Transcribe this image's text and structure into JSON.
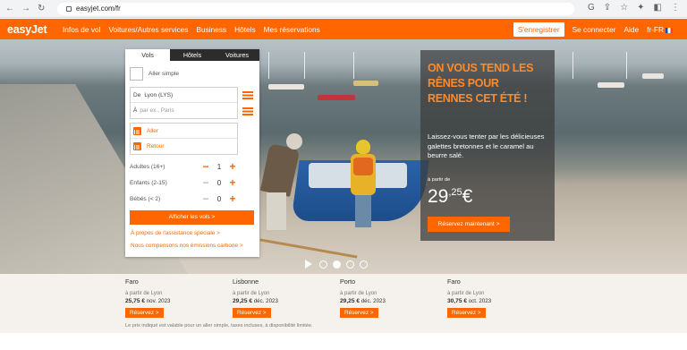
{
  "browser": {
    "url": "easyjet.com/fr",
    "nav_back": "←",
    "nav_forward": "→",
    "nav_reload": "↻",
    "tool_icons": [
      "G",
      "⇪",
      "☆",
      "✦",
      "◧",
      "⋮"
    ]
  },
  "header": {
    "logo": "easyJet",
    "menu": [
      "Infos de vol",
      "Voitures/Autres services",
      "Business",
      "Hôtels",
      "Mes réservations"
    ],
    "register": "S'enregistrer",
    "login": "Se connecter",
    "help": "Aide",
    "lang": "fr-FR"
  },
  "booking": {
    "tabs": [
      "Vols",
      "Hôtels",
      "Voitures"
    ],
    "one_way": "Aller simple",
    "from_label": "De",
    "from_value": "Lyon (LYS)",
    "to_label": "À",
    "to_placeholder": "par ex., Paris",
    "depart": "Aller",
    "return": "Retour",
    "adults_label": "Adultes (16+)",
    "adults": "1",
    "children_label": "Enfants (2-15)",
    "children": "0",
    "infants_label": "Bébés (< 2)",
    "infants": "0",
    "show_flights": "Afficher les vols >",
    "assist_link": "À propos de l'assistance spéciale >",
    "carbon_link": "Nous compensons nos émissions carbone >"
  },
  "promo": {
    "headline": "ON VOUS TEND LES RÊNES POUR RENNES CET ÉTÉ !",
    "description": "Laissez-vous tenter par les délicieuses galettes bretonnes et le caramel au beurre salé.",
    "from": "à partir de",
    "price_int": "29",
    "price_dec": ",25",
    "currency": "€",
    "cta": "Réservez maintenant >"
  },
  "deals": [
    {
      "city": "Faro",
      "from": "à partir de Lyon",
      "price": "25,75 €",
      "date": "nov. 2023",
      "cta": "Réservez >"
    },
    {
      "city": "Lisbonne",
      "from": "à partir de Lyon",
      "price": "29,25 €",
      "date": "déc. 2023",
      "cta": "Réservez >"
    },
    {
      "city": "Porto",
      "from": "à partir de Lyon",
      "price": "29,25 €",
      "date": "déc. 2023",
      "cta": "Réservez >"
    },
    {
      "city": "Faro",
      "from": "à partir de Lyon",
      "price": "30,75 €",
      "date": "oct. 2023",
      "cta": "Réservez >"
    }
  ],
  "disclaimer": "Le prix indiqué est valable pour un aller simple, taxes incluses, à disponibilité limitée.",
  "colors": {
    "brand": "#ff6600",
    "dark": "#2c2c2c"
  }
}
